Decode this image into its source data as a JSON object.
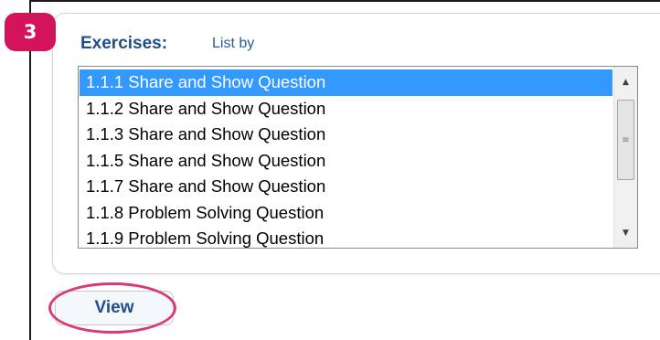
{
  "step_badge": "3",
  "exercises_heading": "Exercises:",
  "list_by_link": "List by",
  "exercises_list": [
    "1.1.1 Share and Show Question",
    "1.1.2 Share and Show Question",
    "1.1.3 Share and Show Question",
    "1.1.5 Share and Show Question",
    "1.1.7 Share and Show Question",
    "1.1.8 Problem Solving Question",
    "1.1.9 Problem Solving Question"
  ],
  "selected_index": 0,
  "view_button_label": "View",
  "scrollbar": {
    "up_arrow": "▲",
    "down_arrow": "▼",
    "grip": "≡"
  },
  "colors": {
    "selection": "#3399ff",
    "heading": "#1f4e8c",
    "badge": "#d4145a",
    "highlight_ring": "#d93a75"
  }
}
